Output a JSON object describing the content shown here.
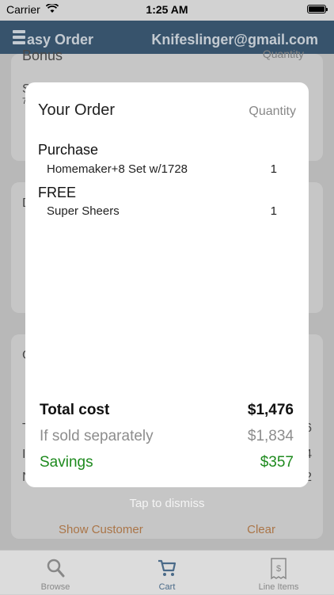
{
  "status_bar": {
    "carrier": "Carrier",
    "time": "1:25 AM"
  },
  "nav": {
    "title": "asy Order",
    "account": "Knifeslinger@gmail.com"
  },
  "background": {
    "card1": {
      "heading": "Bonus",
      "right_label": "Quantity",
      "letter": "S",
      "sub": "7"
    },
    "card2": {
      "letter": "D"
    },
    "card3": {
      "letter": "C",
      "row_letters": [
        "T",
        "I",
        "N"
      ],
      "row_digits": [
        "6",
        "4",
        "2"
      ],
      "show_customer": "Show Customer",
      "clear": "Clear"
    }
  },
  "order": {
    "heading": "Your Order",
    "quantity_label": "Quantity",
    "groups": [
      {
        "title": "Purchase",
        "items": [
          {
            "name": "Homemaker+8 Set w/1728",
            "qty": "1"
          }
        ]
      },
      {
        "title": "FREE",
        "items": [
          {
            "name": "Super Sheers",
            "qty": "1"
          }
        ]
      }
    ],
    "totals": {
      "total_label": "Total cost",
      "total_value": "$1,476",
      "separate_label": "If sold separately",
      "separate_value": "$1,834",
      "savings_label": "Savings",
      "savings_value": "$357"
    },
    "dismiss_hint": "Tap to dismiss"
  },
  "tabs": [
    {
      "label": "Browse",
      "icon": "search-icon"
    },
    {
      "label": "Cart",
      "icon": "cart-icon",
      "active": true
    },
    {
      "label": "Line Items",
      "icon": "receipt-icon"
    }
  ],
  "colors": {
    "nav": "#41627f",
    "savings": "#1e8a1e",
    "accent": "#c88a55"
  }
}
